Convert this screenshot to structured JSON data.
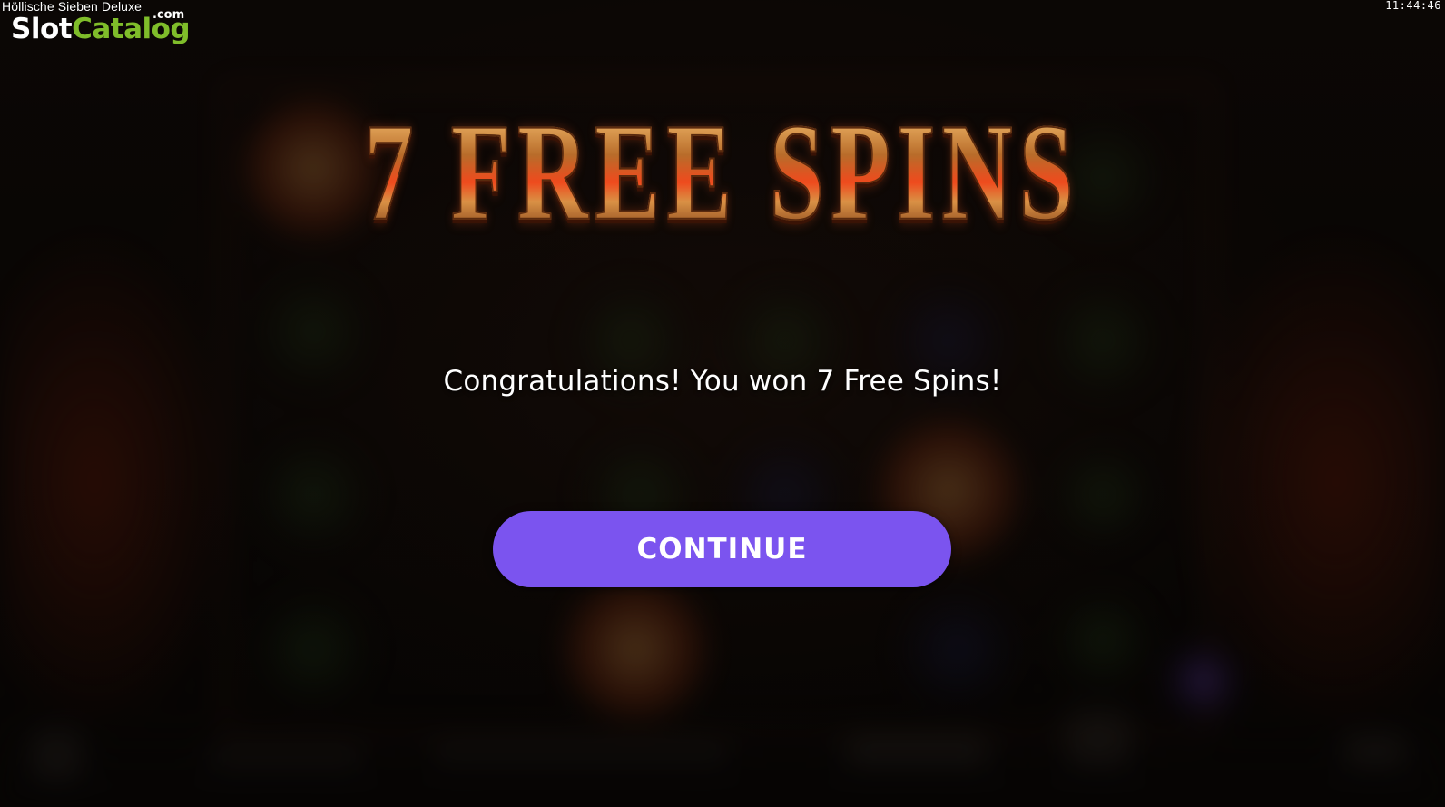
{
  "window": {
    "game_title": "Höllische Sieben Deluxe",
    "clock": "11:44:46"
  },
  "branding": {
    "logo_slot": "Slot",
    "logo_catalog": "Catalog",
    "logo_dotcom": ".com",
    "logo_colors": {
      "slot": "#ffffff",
      "catalog": "#7fbd2a"
    }
  },
  "popup": {
    "headline": "7 FREE SPINS",
    "message": "Congratulations! You won 7 Free Spins!",
    "continue_label": "CONTINUE",
    "button_color": "#7b54ef"
  }
}
